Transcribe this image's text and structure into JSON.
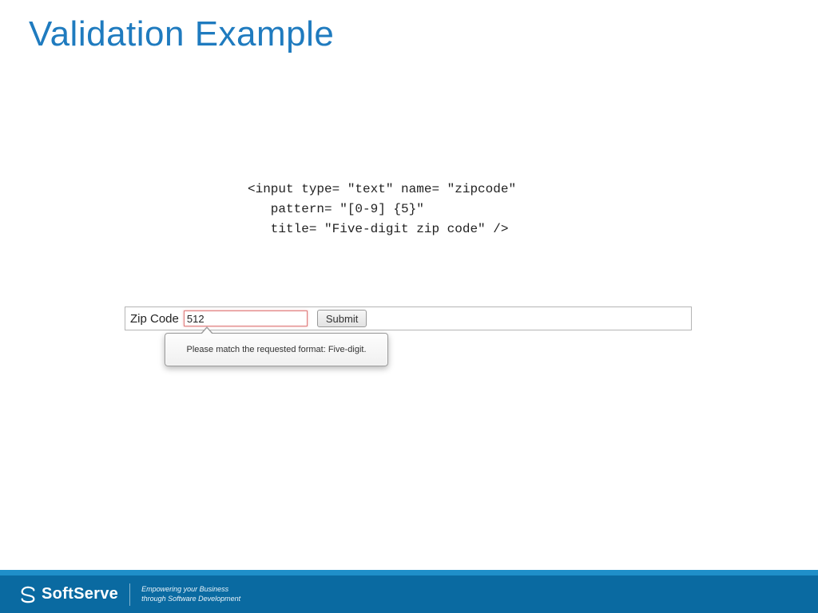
{
  "title": "Validation Example",
  "code": "<input type= \"text\" name= \"zipcode\"\n   pattern= \"[0-9] {5}\"\n   title= \"Five-digit zip code\" />",
  "form": {
    "label": "Zip Code",
    "zip_value": "512",
    "submit_label": "Submit"
  },
  "tooltip": "Please match the requested format: Five-digit.",
  "footer": {
    "brand": "SoftServe",
    "tagline": "Empowering your Business\nthrough Software Development"
  },
  "colors": {
    "title": "#1f7bbf",
    "footer_dark": "#0a6aa1",
    "footer_light": "#1f8fc9",
    "input_error_border": "#e07b7b"
  }
}
